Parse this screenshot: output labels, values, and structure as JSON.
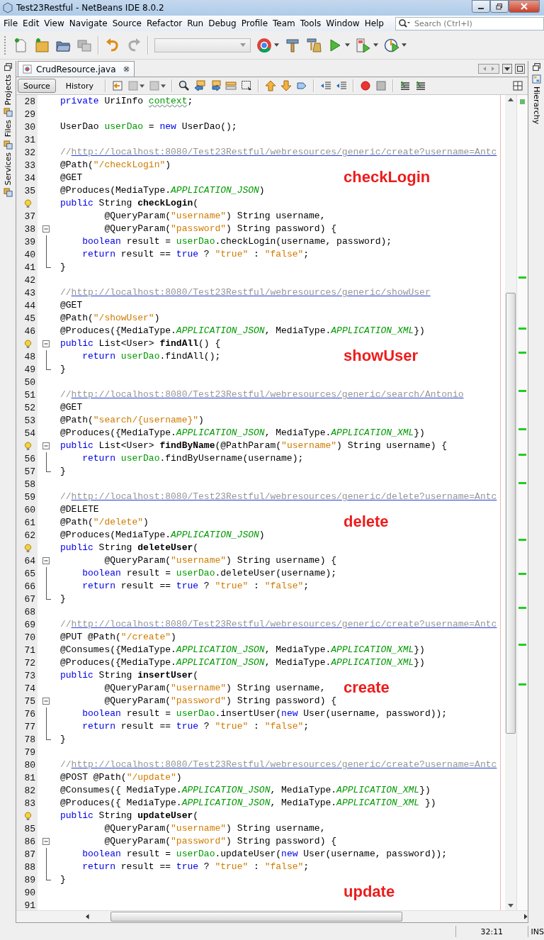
{
  "window": {
    "title": "Test23Restful - NetBeans IDE 8.0.2"
  },
  "menu": [
    "File",
    "Edit",
    "View",
    "Navigate",
    "Source",
    "Refactor",
    "Run",
    "Debug",
    "Profile",
    "Team",
    "Tools",
    "Window",
    "Help"
  ],
  "search": {
    "placeholder": "Search (Ctrl+I)"
  },
  "left_panels": [
    "Projects",
    "Files",
    "Services"
  ],
  "right_panels": [
    "Hierarchy"
  ],
  "editor_tab": {
    "label": "CrudResource.java"
  },
  "view_tabs": [
    {
      "label": "Source",
      "selected": true
    },
    {
      "label": "History",
      "selected": false
    }
  ],
  "lines": [
    {
      "n": "28",
      "code": [
        {
          "kind": "keyword",
          "text": "private"
        },
        {
          "kind": "plain",
          "text": " UriInfo "
        },
        {
          "kind": "warning",
          "text": "context"
        },
        {
          "kind": "plain",
          "text": ";"
        }
      ]
    },
    {
      "n": "29"
    },
    {
      "n": "30",
      "code": [
        {
          "kind": "plain",
          "text": "UserDao "
        },
        {
          "kind": "field",
          "text": "userDao"
        },
        {
          "kind": "plain",
          "text": " = "
        },
        {
          "kind": "keyword",
          "text": "new"
        },
        {
          "kind": "plain",
          "text": " UserDao();"
        }
      ]
    },
    {
      "n": "31"
    },
    {
      "n": "32",
      "code": [
        {
          "kind": "comment",
          "text": "//"
        },
        {
          "kind": "link",
          "text": "http://localhost:8080/Test23Restful/webresources/generic/create?username=Antc"
        }
      ]
    },
    {
      "n": "33",
      "code": [
        {
          "kind": "plain",
          "text": "@Path("
        },
        {
          "kind": "string",
          "text": "\"/checkLogin\""
        },
        {
          "kind": "plain",
          "text": ")"
        }
      ]
    },
    {
      "n": "34",
      "code": [
        {
          "kind": "plain",
          "text": "@GET"
        }
      ],
      "note": "checkLogin"
    },
    {
      "n": "35",
      "code": [
        {
          "kind": "plain",
          "text": "@Produces(MediaType."
        },
        {
          "kind": "constant",
          "text": "APPLICATION_JSON"
        },
        {
          "kind": "plain",
          "text": ")"
        }
      ]
    },
    {
      "marker": {
        "kind": "bulb"
      },
      "code": [
        {
          "kind": "keyword",
          "text": "public"
        },
        {
          "kind": "plain",
          "text": " String "
        },
        {
          "kind": "bold",
          "text": "checkLogin"
        },
        {
          "kind": "plain",
          "text": "("
        }
      ]
    },
    {
      "n": "37",
      "code": [
        {
          "kind": "plain",
          "text": "        @QueryParam("
        },
        {
          "kind": "string",
          "text": "\"username\""
        },
        {
          "kind": "plain",
          "text": ") String username,"
        }
      ]
    },
    {
      "n": "38",
      "fold": {
        "kind": "start"
      },
      "code": [
        {
          "kind": "plain",
          "text": "        @QueryParam("
        },
        {
          "kind": "string",
          "text": "\"password\""
        },
        {
          "kind": "plain",
          "text": ") String password) {"
        }
      ]
    },
    {
      "n": "39",
      "fold": {
        "kind": "mid"
      },
      "code": [
        {
          "kind": "keyword",
          "text": "    boolean"
        },
        {
          "kind": "plain",
          "text": " result = "
        },
        {
          "kind": "field",
          "text": "userDao"
        },
        {
          "kind": "plain",
          "text": ".checkLogin(username, password);"
        }
      ]
    },
    {
      "n": "40",
      "fold": {
        "kind": "mid"
      },
      "code": [
        {
          "kind": "keyword",
          "text": "    return"
        },
        {
          "kind": "plain",
          "text": " result == "
        },
        {
          "kind": "keyword",
          "text": "true"
        },
        {
          "kind": "plain",
          "text": " ? "
        },
        {
          "kind": "string",
          "text": "\"true\""
        },
        {
          "kind": "plain",
          "text": " : "
        },
        {
          "kind": "string",
          "text": "\"false\""
        },
        {
          "kind": "plain",
          "text": ";"
        }
      ]
    },
    {
      "n": "41",
      "fold": {
        "kind": "end"
      },
      "code": [
        {
          "kind": "plain",
          "text": "}"
        }
      ]
    },
    {
      "n": "42"
    },
    {
      "n": "43",
      "code": [
        {
          "kind": "comment",
          "text": "//"
        },
        {
          "kind": "link",
          "text": "http://localhost:8080/Test23Restful/webresources/generic/showUser"
        }
      ]
    },
    {
      "n": "44",
      "code": [
        {
          "kind": "plain",
          "text": "@GET"
        }
      ]
    },
    {
      "n": "45",
      "code": [
        {
          "kind": "plain",
          "text": "@Path("
        },
        {
          "kind": "string",
          "text": "\"/showUser\""
        },
        {
          "kind": "plain",
          "text": ")"
        }
      ]
    },
    {
      "n": "46",
      "code": [
        {
          "kind": "plain",
          "text": "@Produces({MediaType."
        },
        {
          "kind": "constant",
          "text": "APPLICATION_JSON"
        },
        {
          "kind": "plain",
          "text": ", MediaType."
        },
        {
          "kind": "constant",
          "text": "APPLICATION_XML"
        },
        {
          "kind": "plain",
          "text": "})"
        }
      ]
    },
    {
      "marker": {
        "kind": "bulb"
      },
      "fold": {
        "kind": "start"
      },
      "code": [
        {
          "kind": "keyword",
          "text": "public"
        },
        {
          "kind": "plain",
          "text": " List<User> "
        },
        {
          "kind": "bold",
          "text": "findAll"
        },
        {
          "kind": "plain",
          "text": "() {"
        }
      ]
    },
    {
      "n": "48",
      "fold": {
        "kind": "mid"
      },
      "code": [
        {
          "kind": "keyword",
          "text": "    return "
        },
        {
          "kind": "field",
          "text": "userDao"
        },
        {
          "kind": "plain",
          "text": ".findAll();"
        }
      ],
      "note": "showUser"
    },
    {
      "n": "49",
      "fold": {
        "kind": "end"
      },
      "code": [
        {
          "kind": "plain",
          "text": "}"
        }
      ]
    },
    {
      "n": "50"
    },
    {
      "n": "51",
      "code": [
        {
          "kind": "comment",
          "text": "//"
        },
        {
          "kind": "link",
          "text": "http://localhost:8080/Test23Restful/webresources/generic/search/Antonio"
        }
      ]
    },
    {
      "n": "52",
      "code": [
        {
          "kind": "plain",
          "text": "@GET"
        }
      ]
    },
    {
      "n": "53",
      "code": [
        {
          "kind": "plain",
          "text": "@Path("
        },
        {
          "kind": "string",
          "text": "\"search/{username}\""
        },
        {
          "kind": "plain",
          "text": ")"
        }
      ]
    },
    {
      "n": "54",
      "code": [
        {
          "kind": "plain",
          "text": "@Produces({MediaType."
        },
        {
          "kind": "constant",
          "text": "APPLICATION_JSON"
        },
        {
          "kind": "plain",
          "text": ", MediaType."
        },
        {
          "kind": "constant",
          "text": "APPLICATION_XML"
        },
        {
          "kind": "plain",
          "text": "})"
        }
      ]
    },
    {
      "marker": {
        "kind": "bulb"
      },
      "fold": {
        "kind": "start"
      },
      "code": [
        {
          "kind": "keyword",
          "text": "public"
        },
        {
          "kind": "plain",
          "text": " List<User> "
        },
        {
          "kind": "bold",
          "text": "findByName"
        },
        {
          "kind": "plain",
          "text": "(@PathParam("
        },
        {
          "kind": "string",
          "text": "\"username\""
        },
        {
          "kind": "plain",
          "text": ") String username) {"
        }
      ]
    },
    {
      "n": "56",
      "fold": {
        "kind": "mid"
      },
      "code": [
        {
          "kind": "keyword",
          "text": "    return "
        },
        {
          "kind": "field",
          "text": "userDao"
        },
        {
          "kind": "plain",
          "text": ".findByUsername(username);"
        }
      ]
    },
    {
      "n": "57",
      "fold": {
        "kind": "end"
      },
      "code": [
        {
          "kind": "plain",
          "text": "}"
        }
      ]
    },
    {
      "n": "58"
    },
    {
      "n": "59",
      "code": [
        {
          "kind": "comment",
          "text": "//"
        },
        {
          "kind": "link",
          "text": "http://localhost:8080/Test23Restful/webresources/generic/delete?username=Antc"
        }
      ]
    },
    {
      "n": "60",
      "code": [
        {
          "kind": "plain",
          "text": "@DELETE"
        }
      ]
    },
    {
      "n": "61",
      "code": [
        {
          "kind": "plain",
          "text": "@Path("
        },
        {
          "kind": "string",
          "text": "\"/delete\""
        },
        {
          "kind": "plain",
          "text": ")"
        }
      ],
      "note": "delete"
    },
    {
      "n": "62",
      "code": [
        {
          "kind": "plain",
          "text": "@Produces(MediaType."
        },
        {
          "kind": "constant",
          "text": "APPLICATION_JSON"
        },
        {
          "kind": "plain",
          "text": ")"
        }
      ]
    },
    {
      "marker": {
        "kind": "bulb"
      },
      "code": [
        {
          "kind": "keyword",
          "text": "public"
        },
        {
          "kind": "plain",
          "text": " String "
        },
        {
          "kind": "bold",
          "text": "deleteUser"
        },
        {
          "kind": "plain",
          "text": "("
        }
      ]
    },
    {
      "n": "64",
      "fold": {
        "kind": "start"
      },
      "code": [
        {
          "kind": "plain",
          "text": "        @QueryParam("
        },
        {
          "kind": "string",
          "text": "\"username\""
        },
        {
          "kind": "plain",
          "text": ") String username) {"
        }
      ]
    },
    {
      "n": "65",
      "fold": {
        "kind": "mid"
      },
      "code": [
        {
          "kind": "keyword",
          "text": "    boolean"
        },
        {
          "kind": "plain",
          "text": " result = "
        },
        {
          "kind": "field",
          "text": "userDao"
        },
        {
          "kind": "plain",
          "text": ".deleteUser(username);"
        }
      ]
    },
    {
      "n": "66",
      "fold": {
        "kind": "mid"
      },
      "code": [
        {
          "kind": "keyword",
          "text": "    return"
        },
        {
          "kind": "plain",
          "text": " result == "
        },
        {
          "kind": "keyword",
          "text": "true"
        },
        {
          "kind": "plain",
          "text": " ? "
        },
        {
          "kind": "string",
          "text": "\"true\""
        },
        {
          "kind": "plain",
          "text": " : "
        },
        {
          "kind": "string",
          "text": "\"false\""
        },
        {
          "kind": "plain",
          "text": ";"
        }
      ]
    },
    {
      "n": "67",
      "fold": {
        "kind": "end"
      },
      "code": [
        {
          "kind": "plain",
          "text": "}"
        }
      ]
    },
    {
      "n": "68"
    },
    {
      "n": "69",
      "code": [
        {
          "kind": "comment",
          "text": "//"
        },
        {
          "kind": "link",
          "text": "http://localhost:8080/Test23Restful/webresources/generic/create?username=Antc"
        }
      ]
    },
    {
      "n": "70",
      "code": [
        {
          "kind": "plain",
          "text": "@PUT @Path("
        },
        {
          "kind": "string",
          "text": "\"/create\""
        },
        {
          "kind": "plain",
          "text": ")"
        }
      ]
    },
    {
      "n": "71",
      "code": [
        {
          "kind": "plain",
          "text": "@Consumes({MediaType."
        },
        {
          "kind": "constant",
          "text": "APPLICATION_JSON"
        },
        {
          "kind": "plain",
          "text": ", MediaType."
        },
        {
          "kind": "constant",
          "text": "APPLICATION_XML"
        },
        {
          "kind": "plain",
          "text": "})"
        }
      ]
    },
    {
      "n": "72",
      "code": [
        {
          "kind": "plain",
          "text": "@Produces({MediaType."
        },
        {
          "kind": "constant",
          "text": "APPLICATION_JSON"
        },
        {
          "kind": "plain",
          "text": ", MediaType."
        },
        {
          "kind": "constant",
          "text": "APPLICATION_XML"
        },
        {
          "kind": "plain",
          "text": "})"
        }
      ]
    },
    {
      "n": "73",
      "code": [
        {
          "kind": "keyword",
          "text": "public"
        },
        {
          "kind": "plain",
          "text": " String "
        },
        {
          "kind": "bold",
          "text": "insertUser"
        },
        {
          "kind": "plain",
          "text": "("
        }
      ]
    },
    {
      "n": "74",
      "code": [
        {
          "kind": "plain",
          "text": "        @QueryParam("
        },
        {
          "kind": "string",
          "text": "\"username\""
        },
        {
          "kind": "plain",
          "text": ") String username,"
        }
      ],
      "note": "create"
    },
    {
      "n": "75",
      "fold": {
        "kind": "start"
      },
      "code": [
        {
          "kind": "plain",
          "text": "        @QueryParam("
        },
        {
          "kind": "string",
          "text": "\"password\""
        },
        {
          "kind": "plain",
          "text": ") String password) {"
        }
      ]
    },
    {
      "n": "76",
      "fold": {
        "kind": "mid"
      },
      "code": [
        {
          "kind": "keyword",
          "text": "    boolean"
        },
        {
          "kind": "plain",
          "text": " result = "
        },
        {
          "kind": "field",
          "text": "userDao"
        },
        {
          "kind": "plain",
          "text": ".insertUser("
        },
        {
          "kind": "keyword",
          "text": "new"
        },
        {
          "kind": "plain",
          "text": " User(username, password));"
        }
      ]
    },
    {
      "n": "77",
      "fold": {
        "kind": "mid"
      },
      "code": [
        {
          "kind": "keyword",
          "text": "    return"
        },
        {
          "kind": "plain",
          "text": " result == "
        },
        {
          "kind": "keyword",
          "text": "true"
        },
        {
          "kind": "plain",
          "text": " ? "
        },
        {
          "kind": "string",
          "text": "\"true\""
        },
        {
          "kind": "plain",
          "text": " : "
        },
        {
          "kind": "string",
          "text": "\"false\""
        },
        {
          "kind": "plain",
          "text": ";"
        }
      ]
    },
    {
      "n": "78",
      "fold": {
        "kind": "end"
      },
      "code": [
        {
          "kind": "plain",
          "text": "}"
        }
      ]
    },
    {
      "n": "79"
    },
    {
      "n": "80",
      "code": [
        {
          "kind": "comment",
          "text": "//"
        },
        {
          "kind": "link",
          "text": "http://localhost:8080/Test23Restful/webresources/generic/create?username=Antc"
        }
      ]
    },
    {
      "n": "81",
      "code": [
        {
          "kind": "plain",
          "text": "@POST @Path("
        },
        {
          "kind": "string",
          "text": "\"/update\""
        },
        {
          "kind": "plain",
          "text": ")"
        }
      ]
    },
    {
      "n": "82",
      "code": [
        {
          "kind": "plain",
          "text": "@Consumes({ MediaType."
        },
        {
          "kind": "constant",
          "text": "APPLICATION_JSON"
        },
        {
          "kind": "plain",
          "text": ", MediaType."
        },
        {
          "kind": "constant",
          "text": "APPLICATION_XML"
        },
        {
          "kind": "plain",
          "text": "})"
        }
      ]
    },
    {
      "n": "83",
      "code": [
        {
          "kind": "plain",
          "text": "@Produces({ MediaType."
        },
        {
          "kind": "constant",
          "text": "APPLICATION_JSON"
        },
        {
          "kind": "plain",
          "text": ", MediaType."
        },
        {
          "kind": "constant",
          "text": "APPLICATION_XML"
        },
        {
          "kind": "plain",
          "text": " })"
        }
      ]
    },
    {
      "marker": {
        "kind": "bulb"
      },
      "code": [
        {
          "kind": "keyword",
          "text": "public"
        },
        {
          "kind": "plain",
          "text": " String "
        },
        {
          "kind": "bold",
          "text": "updateUser"
        },
        {
          "kind": "plain",
          "text": "("
        }
      ]
    },
    {
      "n": "85",
      "code": [
        {
          "kind": "plain",
          "text": "        @QueryParam("
        },
        {
          "kind": "string",
          "text": "\"username\""
        },
        {
          "kind": "plain",
          "text": ") String username,"
        }
      ]
    },
    {
      "n": "86",
      "fold": {
        "kind": "start"
      },
      "code": [
        {
          "kind": "plain",
          "text": "        @QueryParam("
        },
        {
          "kind": "string",
          "text": "\"password\""
        },
        {
          "kind": "plain",
          "text": ") String password) {"
        }
      ]
    },
    {
      "n": "87",
      "fold": {
        "kind": "mid"
      },
      "code": [
        {
          "kind": "keyword",
          "text": "    boolean"
        },
        {
          "kind": "plain",
          "text": " result = "
        },
        {
          "kind": "field",
          "text": "userDao"
        },
        {
          "kind": "plain",
          "text": ".updateUser("
        },
        {
          "kind": "keyword",
          "text": "new"
        },
        {
          "kind": "plain",
          "text": " User(username, password));"
        }
      ]
    },
    {
      "n": "88",
      "fold": {
        "kind": "mid"
      },
      "code": [
        {
          "kind": "keyword",
          "text": "    return"
        },
        {
          "kind": "plain",
          "text": " result == "
        },
        {
          "kind": "keyword",
          "text": "true"
        },
        {
          "kind": "plain",
          "text": " ? "
        },
        {
          "kind": "string",
          "text": "\"true\""
        },
        {
          "kind": "plain",
          "text": " : "
        },
        {
          "kind": "string",
          "text": "\"false\""
        },
        {
          "kind": "plain",
          "text": ";"
        }
      ]
    },
    {
      "n": "89",
      "fold": {
        "kind": "end"
      },
      "code": [
        {
          "kind": "plain",
          "text": "}"
        }
      ]
    },
    {
      "n": "90",
      "note": "update"
    },
    {
      "n": "91"
    }
  ],
  "status_bar": {
    "position": "32:11",
    "mode": "INS"
  }
}
